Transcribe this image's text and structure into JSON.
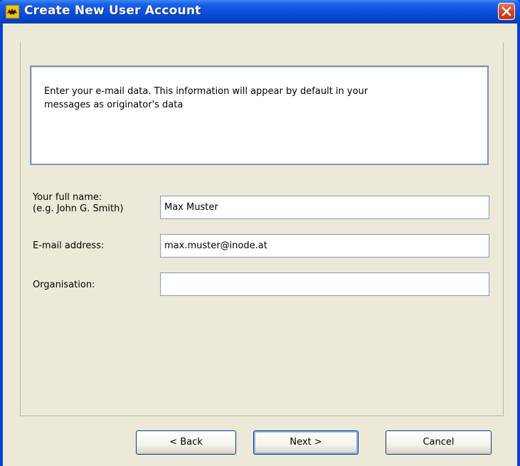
{
  "window": {
    "title": "Create New User Account"
  },
  "info": {
    "line1": "Enter your e-mail data. This information will appear by default in your",
    "line2": "messages as originator's data"
  },
  "form": {
    "full_name_label_line1": "Your full name:",
    "full_name_label_line2": "(e.g. John G. Smith)",
    "full_name_value": "Max Muster",
    "email_label": "E-mail address:",
    "email_value": "max.muster@inode.at",
    "organisation_label": "Organisation:",
    "organisation_value": ""
  },
  "buttons": {
    "back": "< Back",
    "next": "Next >",
    "cancel": "Cancel"
  },
  "colors": {
    "titlebar": "#0a4fd9",
    "dialog_bg": "#ece9d8",
    "close_red": "#d8441c"
  },
  "icons": {
    "app": "bat-icon",
    "close": "close-icon"
  }
}
